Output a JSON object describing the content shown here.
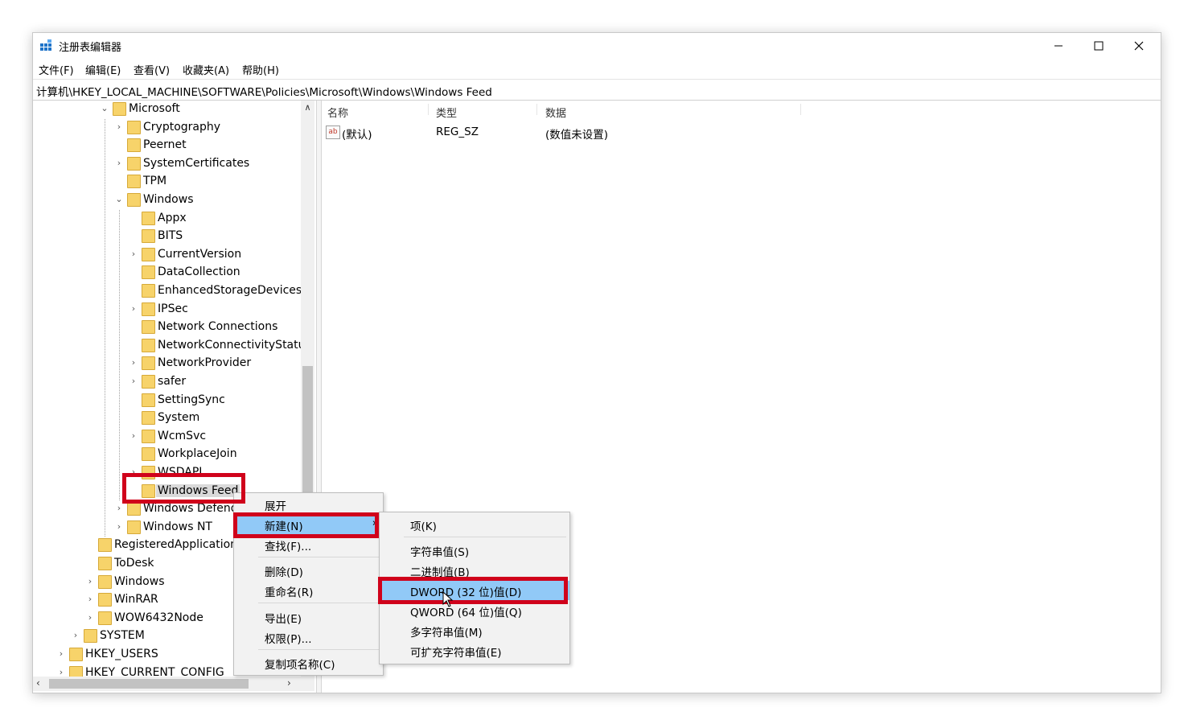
{
  "window": {
    "title": "注册表编辑器"
  },
  "menu": [
    "文件(F)",
    "编辑(E)",
    "查看(V)",
    "收藏夹(A)",
    "帮助(H)"
  ],
  "address": "计算机\\HKEY_LOCAL_MACHINE\\SOFTWARE\\Policies\\Microsoft\\Windows\\Windows Feed",
  "tree": [
    {
      "label": "Microsoft",
      "chev": "⌄"
    },
    {
      "label": "Cryptography",
      "chev": "›"
    },
    {
      "label": "Peernet",
      "chev": ""
    },
    {
      "label": "SystemCertificates",
      "chev": "›"
    },
    {
      "label": "TPM",
      "chev": ""
    },
    {
      "label": "Windows",
      "chev": "⌄"
    },
    {
      "label": "Appx",
      "chev": ""
    },
    {
      "label": "BITS",
      "chev": ""
    },
    {
      "label": "CurrentVersion",
      "chev": "›"
    },
    {
      "label": "DataCollection",
      "chev": ""
    },
    {
      "label": "EnhancedStorageDevices",
      "chev": ""
    },
    {
      "label": "IPSec",
      "chev": "›"
    },
    {
      "label": "Network Connections",
      "chev": ""
    },
    {
      "label": "NetworkConnectivityStatusI",
      "chev": ""
    },
    {
      "label": "NetworkProvider",
      "chev": "›"
    },
    {
      "label": "safer",
      "chev": "›"
    },
    {
      "label": "SettingSync",
      "chev": ""
    },
    {
      "label": "System",
      "chev": ""
    },
    {
      "label": "WcmSvc",
      "chev": "›"
    },
    {
      "label": "WorkplaceJoin",
      "chev": ""
    },
    {
      "label": "WSDAPI",
      "chev": "›"
    },
    {
      "label": "Windows Feed",
      "chev": ""
    },
    {
      "label": "Windows Defend",
      "chev": "›"
    },
    {
      "label": "Windows NT",
      "chev": "›"
    },
    {
      "label": "RegisteredApplications",
      "chev": ""
    },
    {
      "label": "ToDesk",
      "chev": ""
    },
    {
      "label": "Windows",
      "chev": "›"
    },
    {
      "label": "WinRAR",
      "chev": "›"
    },
    {
      "label": "WOW6432Node",
      "chev": "›"
    },
    {
      "label": "SYSTEM",
      "chev": "›"
    },
    {
      "label": "HKEY_USERS",
      "chev": "›"
    },
    {
      "label": "HKEY_CURRENT_CONFIG",
      "chev": "›"
    }
  ],
  "columns": {
    "name": "名称",
    "type": "类型",
    "data": "数据"
  },
  "values": [
    {
      "icon": "ab",
      "name": "(默认)",
      "type": "REG_SZ",
      "data": "(数值未设置)"
    }
  ],
  "context_menu": [
    "展开",
    "新建(N)",
    "查找(F)...",
    "删除(D)",
    "重命名(R)",
    "导出(E)",
    "权限(P)...",
    "复制项名称(C)"
  ],
  "submenu": [
    "项(K)",
    "字符串值(S)",
    "二进制值(B)",
    "DWORD (32 位)值(D)",
    "QWORD (64 位)值(Q)",
    "多字符串值(M)",
    "可扩充字符串值(E)"
  ],
  "colors": {
    "highlight": "#91c9f7",
    "annotation": "#d0021b",
    "folder": "#f7d36a"
  }
}
